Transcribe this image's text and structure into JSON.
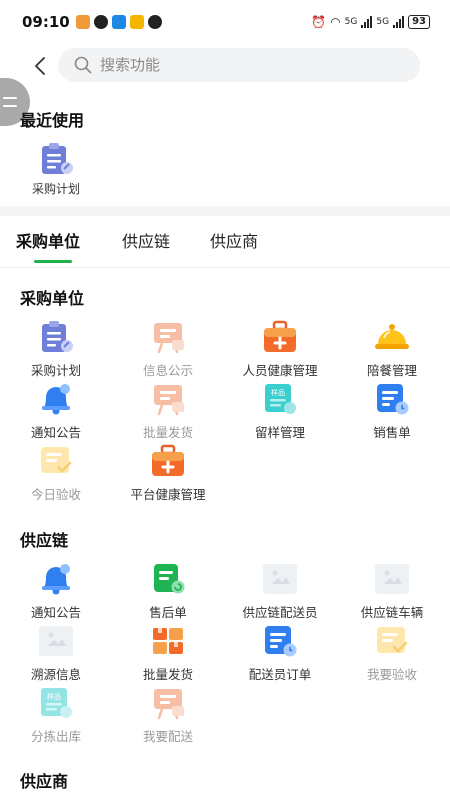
{
  "status_bar": {
    "time": "09:10",
    "network_label_1": "5G",
    "network_label_2": "5G",
    "battery": "93"
  },
  "search": {
    "placeholder": "搜索功能"
  },
  "recent": {
    "title": "最近使用",
    "items": [
      {
        "label": "采购计划",
        "icon": "clipboard-icon"
      }
    ]
  },
  "tabs": [
    {
      "label": "采购单位",
      "active": true
    },
    {
      "label": "供应链",
      "active": false
    },
    {
      "label": "供应商",
      "active": false
    }
  ],
  "sections": [
    {
      "title": "采购单位",
      "items": [
        {
          "label": "采购计划",
          "icon": "clipboard-icon",
          "muted": false
        },
        {
          "label": "信息公示",
          "icon": "easel-board-icon",
          "muted": true
        },
        {
          "label": "人员健康管理",
          "icon": "medical-kit-icon",
          "muted": false
        },
        {
          "label": "陪餐管理",
          "icon": "food-cloche-icon",
          "muted": false
        },
        {
          "label": "通知公告",
          "icon": "bell-icon",
          "muted": false
        },
        {
          "label": "批量发货",
          "icon": "easel-board-icon",
          "muted": true
        },
        {
          "label": "留样管理",
          "icon": "sample-card-icon",
          "muted": false
        },
        {
          "label": "销售单",
          "icon": "document-clock-icon",
          "muted": false
        },
        {
          "label": "今日验收",
          "icon": "check-note-icon",
          "muted": true
        },
        {
          "label": "平台健康管理",
          "icon": "medical-kit-icon",
          "muted": false
        }
      ]
    },
    {
      "title": "供应链",
      "items": [
        {
          "label": "通知公告",
          "icon": "bell-icon",
          "muted": false
        },
        {
          "label": "售后单",
          "icon": "receipt-refresh-icon",
          "muted": false
        },
        {
          "label": "供应链配送员",
          "icon": "image-placeholder-icon",
          "muted": false
        },
        {
          "label": "供应链车辆",
          "icon": "image-placeholder-icon",
          "muted": false
        },
        {
          "label": "溯源信息",
          "icon": "image-placeholder-icon",
          "muted": false
        },
        {
          "label": "批量发货",
          "icon": "boxes-icon",
          "muted": false
        },
        {
          "label": "配送员订单",
          "icon": "document-clock-icon",
          "muted": false
        },
        {
          "label": "我要验收",
          "icon": "check-note-icon",
          "muted": true
        },
        {
          "label": "分拣出库",
          "icon": "sample-card-icon",
          "muted": true
        },
        {
          "label": "我要配送",
          "icon": "easel-board-icon",
          "muted": true
        }
      ]
    },
    {
      "title": "供应商",
      "items": []
    }
  ],
  "icon_badge_text": "样品",
  "colors": {
    "accent_green": "#22b04a",
    "muted_text": "#9a9a9a"
  }
}
